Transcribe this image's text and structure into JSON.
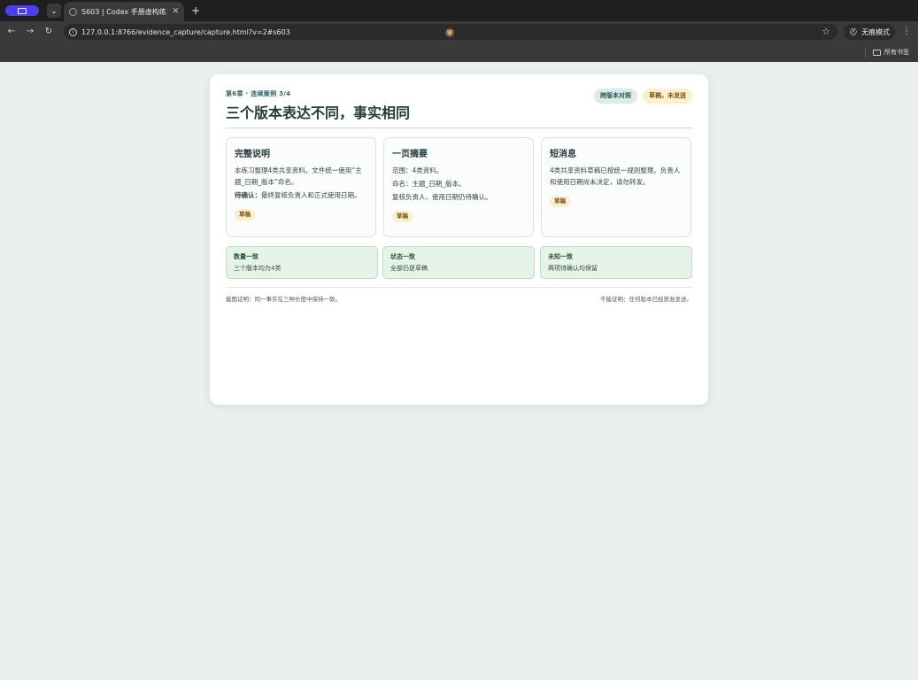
{
  "browser": {
    "tab_title": "S603 | Codex 手册虚构练习",
    "tab_close": "✕",
    "new_tab": "+",
    "url": "127.0.0.1:8766/evidence_capture/capture.html?v=2#s603",
    "incognito_label": "无痕模式",
    "bookmarks_all": "所有书签"
  },
  "page": {
    "kicker": "第6章 · 连续案例 3/4",
    "title": "三个版本表达不同，事实相同",
    "badges": [
      "跨版本对照",
      "草稿，未发送"
    ],
    "versions": [
      {
        "title": "完整说明",
        "line1": "本练习整理4类共享资料。文件统一使用“主题_日期_版本”命名。",
        "pending_label": "待确认：",
        "pending_text": "最终复核负责人和正式使用日期。",
        "tag": "草稿"
      },
      {
        "title": "一页摘要",
        "line1": "范围：4类资料。",
        "line2": "命名：主题_日期_版本。",
        "line3": "复核负责人、使用日期仍待确认。",
        "tag": "草稿"
      },
      {
        "title": "短消息",
        "line1": "4类共享资料草稿已按统一规则整理。负责人和使用日期尚未决定，请勿转发。",
        "tag": "草稿"
      }
    ],
    "checks": [
      {
        "title": "数量一致",
        "desc": "三个版本均为4类"
      },
      {
        "title": "状态一致",
        "desc": "全部仍是草稿"
      },
      {
        "title": "未知一致",
        "desc": "两项待确认均保留"
      }
    ],
    "footer_left": "截图证明：同一事实在三种长度中保持一致。",
    "footer_right": "不能证明：任何版本已经获准发送。"
  }
}
